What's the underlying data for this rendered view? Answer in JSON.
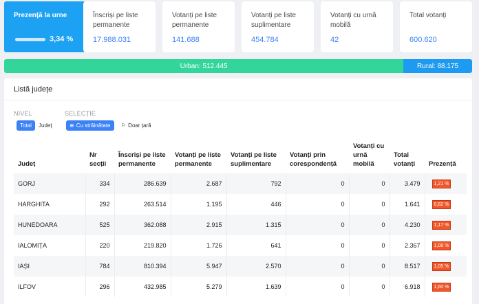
{
  "stats": {
    "presence": {
      "label": "Prezență la urne",
      "value": "3,34 %",
      "fraction": 0.0334
    },
    "cards": [
      {
        "label": "Înscriși pe liste permanente",
        "value": "17.988.031"
      },
      {
        "label": "Votanți pe liste permanente",
        "value": "141.688"
      },
      {
        "label": "Votanți pe liste suplimentare",
        "value": "454.784"
      },
      {
        "label": "Votanți cu urnă mobilă",
        "value": "42"
      },
      {
        "label": "Total votanți",
        "value": "600.620"
      }
    ]
  },
  "split": {
    "urban": "Urban: 512.445",
    "rural": "Rural: 88.175",
    "urban_value": 512445,
    "rural_value": 88175
  },
  "panel": {
    "title": "Listă județe",
    "nivel_label": "NIVEL",
    "selectie_label": "SELECȚIE",
    "nivel_options": [
      "Total",
      "Județ"
    ],
    "selectie_options": [
      "Cu străinătate",
      "Doar țară"
    ]
  },
  "table": {
    "headers": [
      "Județ",
      "Nr secții",
      "Înscriși pe liste permanente",
      "Votanți pe liste permanente",
      "Votanți pe liste suplimentare",
      "Votanți prin corespondență",
      "Votanți cu urnă mobilă",
      "Total votanți",
      "Prezență"
    ],
    "rows": [
      [
        "GORJ",
        "334",
        "286.639",
        "2.687",
        "792",
        "0",
        "0",
        "3.479",
        "1,21 %"
      ],
      [
        "HARGHITA",
        "292",
        "263.514",
        "1.195",
        "446",
        "0",
        "0",
        "1.641",
        "0,62 %"
      ],
      [
        "HUNEDOARA",
        "525",
        "362.088",
        "2.915",
        "1.315",
        "0",
        "0",
        "4.230",
        "1,17 %"
      ],
      [
        "IALOMIȚA",
        "220",
        "219.820",
        "1.726",
        "641",
        "0",
        "0",
        "2.367",
        "1,08 %"
      ],
      [
        "IAȘI",
        "784",
        "810.394",
        "5.947",
        "2.570",
        "0",
        "0",
        "8.517",
        "1,05 %"
      ],
      [
        "ILFOV",
        "296",
        "432.985",
        "5.279",
        "1.639",
        "0",
        "0",
        "6.918",
        "1,60 %"
      ]
    ]
  },
  "colors": {
    "primary": "#1da1f2",
    "urban": "#33d69a",
    "rural": "#1d9bf0",
    "accent": "#3b82f6",
    "badge": "#f2572b"
  }
}
